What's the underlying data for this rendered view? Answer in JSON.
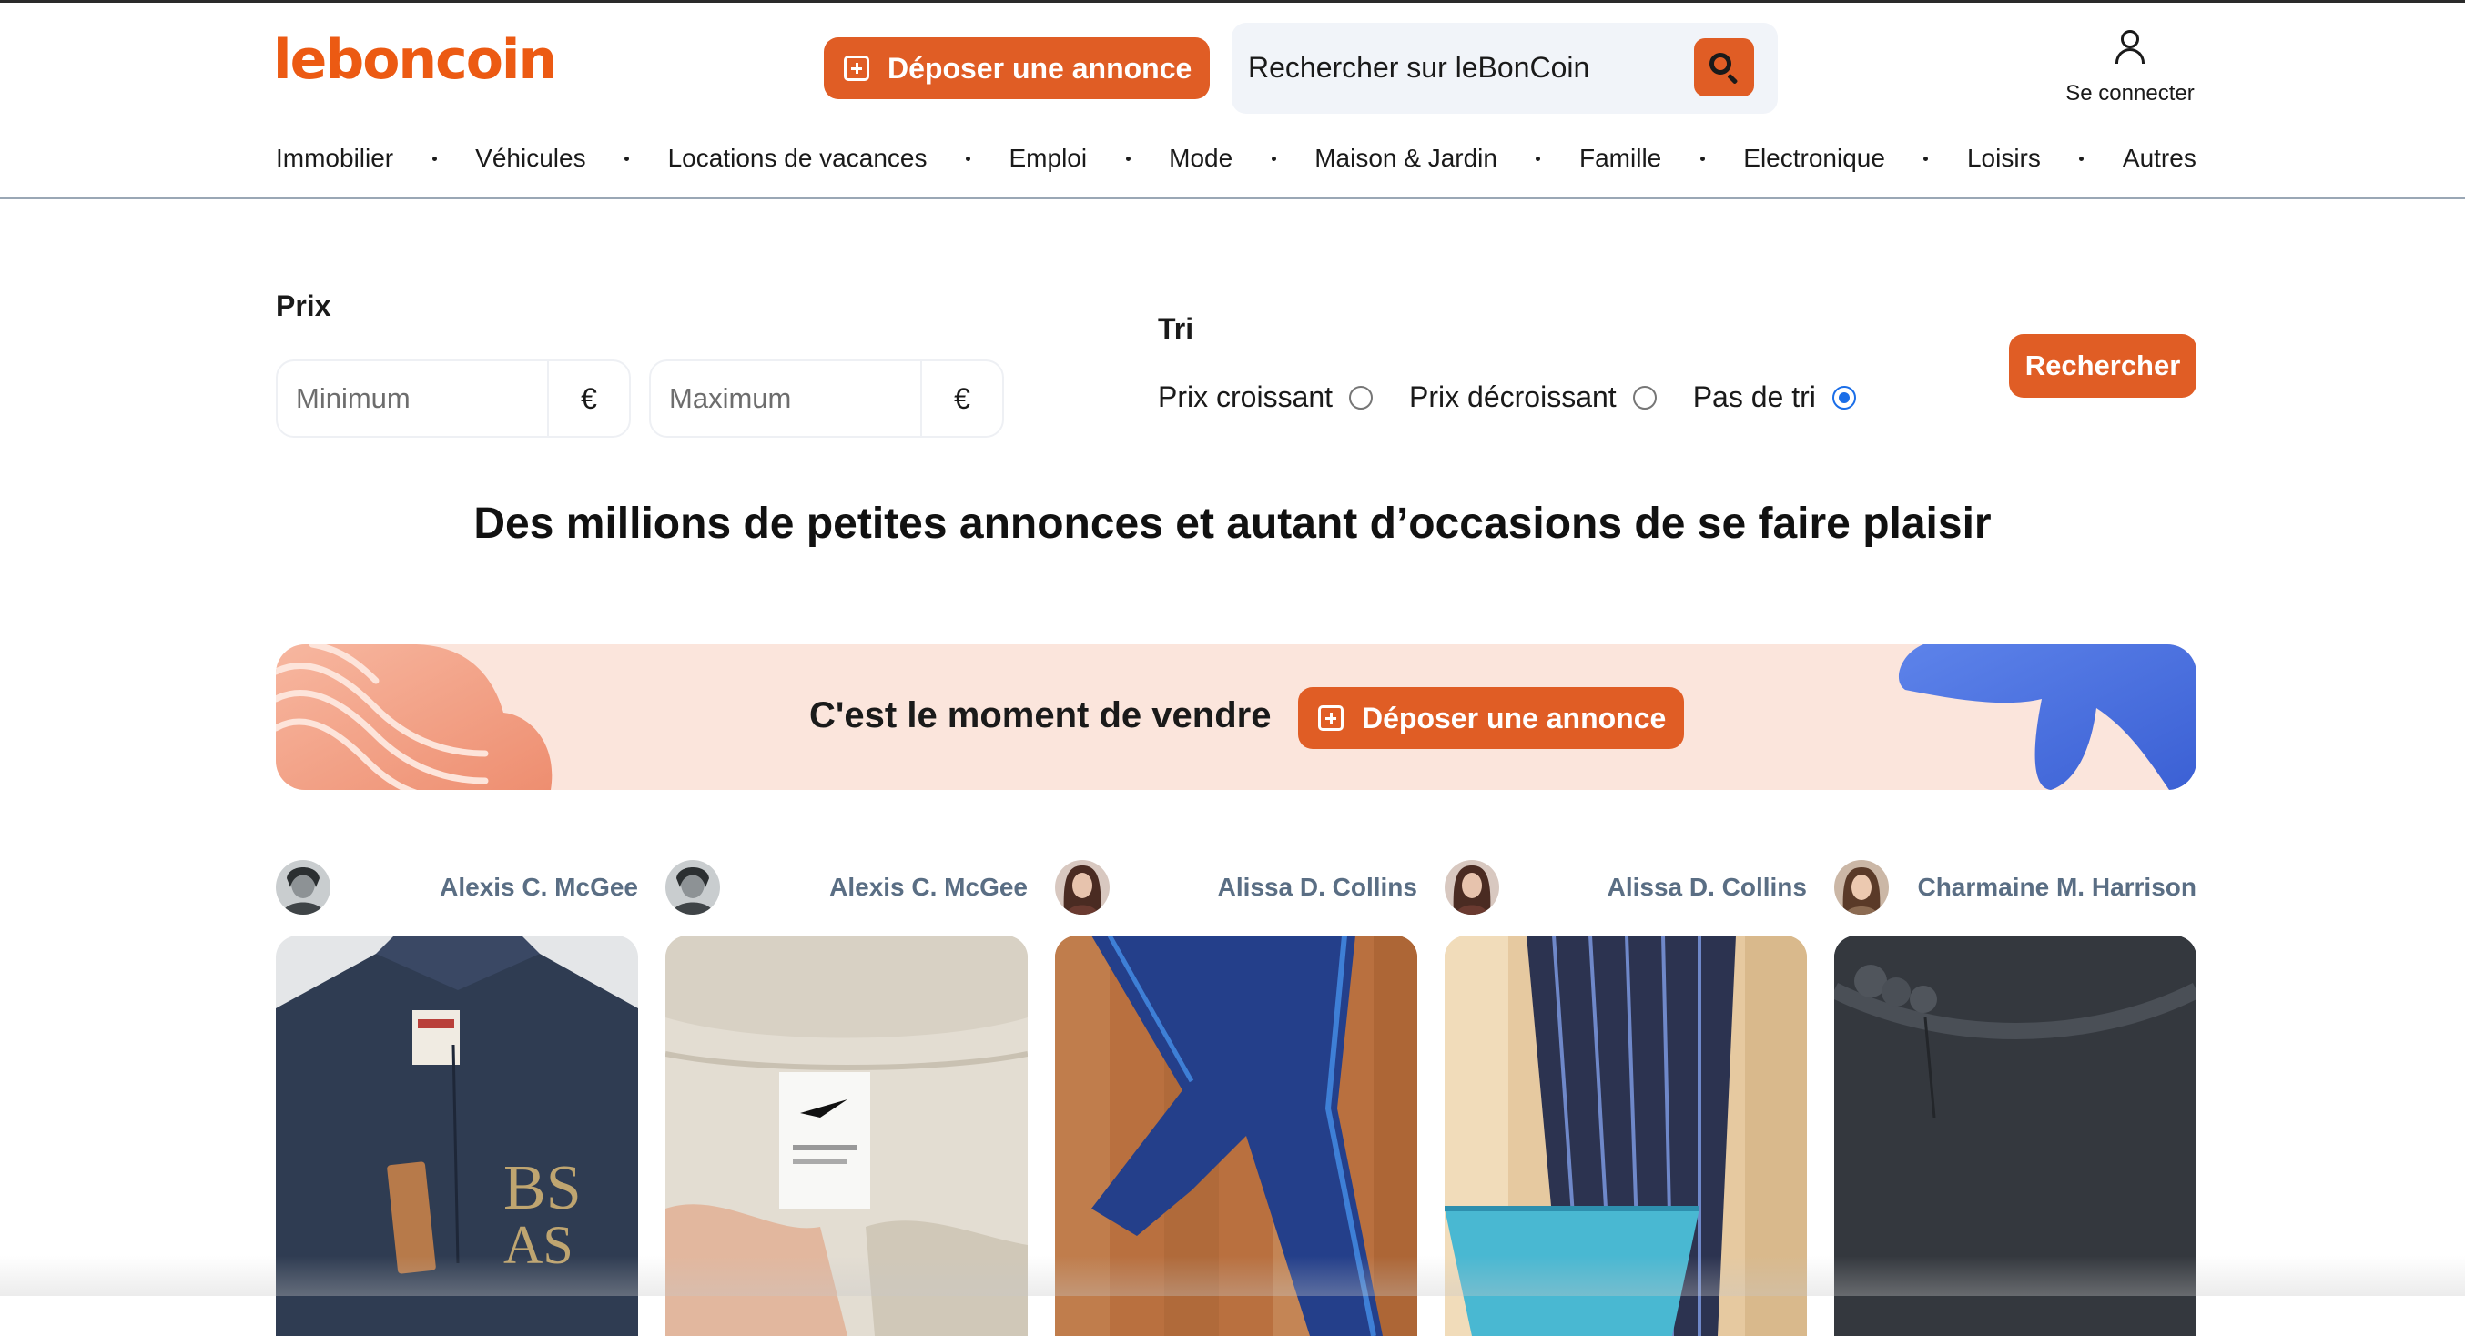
{
  "header": {
    "logo": "leboncoin",
    "post_button": "Déposer une annonce",
    "search_placeholder": "Rechercher sur leBonCoin",
    "login_label": "Se connecter"
  },
  "nav": {
    "items": [
      "Immobilier",
      "Véhicules",
      "Locations de vacances",
      "Emploi",
      "Mode",
      "Maison & Jardin",
      "Famille",
      "Electronique",
      "Loisirs",
      "Autres"
    ]
  },
  "filters": {
    "price_label": "Prix",
    "min_placeholder": "Minimum",
    "max_placeholder": "Maximum",
    "currency": "€",
    "sort_label": "Tri",
    "sort_options": [
      {
        "label": "Prix croissant",
        "checked": false
      },
      {
        "label": "Prix décroissant",
        "checked": false
      },
      {
        "label": "Pas de tri",
        "checked": true
      }
    ],
    "search_button": "Rechercher"
  },
  "headline": "Des millions de petites annonces et autant d’occasions de se faire plaisir",
  "banner": {
    "title": "C'est le moment de vendre",
    "button": "Déposer une annonce"
  },
  "listings": [
    {
      "seller": "Alexis C. McGee"
    },
    {
      "seller": "Alexis C. McGee"
    },
    {
      "seller": "Alissa D. Collins"
    },
    {
      "seller": "Alissa D. Collins"
    },
    {
      "seller": "Charmaine M. Harrison"
    }
  ],
  "colors": {
    "brand": "#ec5a13",
    "button": "#e05d25",
    "banner_bg": "#fbe5dc",
    "seller_name": "#5a6e84",
    "radio_checked": "#1a6ee8"
  }
}
